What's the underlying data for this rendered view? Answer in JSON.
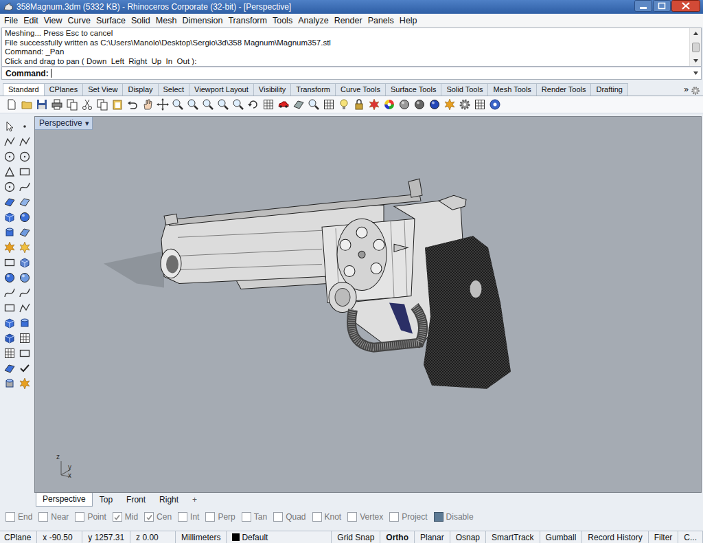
{
  "window": {
    "title": "358Magnum.3dm (5332 KB) - Rhinoceros Corporate (32-bit) - [Perspective]"
  },
  "menu": [
    "File",
    "Edit",
    "View",
    "Curve",
    "Surface",
    "Solid",
    "Mesh",
    "Dimension",
    "Transform",
    "Tools",
    "Analyze",
    "Render",
    "Panels",
    "Help"
  ],
  "command_history": [
    "Meshing... Press Esc to cancel",
    "File successfully written as C:\\Users\\Manolo\\Desktop\\Sergio\\3d\\358 Magnum\\Magnum357.stl",
    "Command: _Pan",
    "Click and drag to pan ( Down  Left  Right  Up  In  Out ):"
  ],
  "command_line": {
    "label": "Command:"
  },
  "toolbar_tabs": [
    {
      "label": "Standard",
      "selected": true
    },
    {
      "label": "CPlanes",
      "selected": false
    },
    {
      "label": "Set View",
      "selected": false
    },
    {
      "label": "Display",
      "selected": false
    },
    {
      "label": "Select",
      "selected": false
    },
    {
      "label": "Viewport Layout",
      "selected": false
    },
    {
      "label": "Visibility",
      "selected": false
    },
    {
      "label": "Transform",
      "selected": false
    },
    {
      "label": "Curve Tools",
      "selected": false
    },
    {
      "label": "Surface Tools",
      "selected": false
    },
    {
      "label": "Solid Tools",
      "selected": false
    },
    {
      "label": "Mesh Tools",
      "selected": false
    },
    {
      "label": "Render Tools",
      "selected": false
    },
    {
      "label": "Drafting",
      "selected": false
    }
  ],
  "toolbar_tabs_more": "»",
  "viewport": {
    "label": "Perspective",
    "menu_glyph": "▾",
    "axes": [
      "z",
      "y",
      "x"
    ]
  },
  "viewport_tabs": [
    {
      "label": "Perspective",
      "selected": true
    },
    {
      "label": "Top",
      "selected": false
    },
    {
      "label": "Front",
      "selected": false
    },
    {
      "label": "Right",
      "selected": false
    }
  ],
  "viewport_tab_add": "+",
  "osnaps": [
    {
      "label": "End",
      "checked": false,
      "kind": "check"
    },
    {
      "label": "Near",
      "checked": false,
      "kind": "check"
    },
    {
      "label": "Point",
      "checked": false,
      "kind": "check"
    },
    {
      "label": "Mid",
      "checked": true,
      "kind": "check"
    },
    {
      "label": "Cen",
      "checked": true,
      "kind": "check"
    },
    {
      "label": "Int",
      "checked": false,
      "kind": "check"
    },
    {
      "label": "Perp",
      "checked": false,
      "kind": "check"
    },
    {
      "label": "Tan",
      "checked": false,
      "kind": "check"
    },
    {
      "label": "Quad",
      "checked": false,
      "kind": "check"
    },
    {
      "label": "Knot",
      "checked": false,
      "kind": "check"
    },
    {
      "label": "Vertex",
      "checked": false,
      "kind": "check"
    },
    {
      "label": "Project",
      "checked": false,
      "kind": "check"
    },
    {
      "label": "Disable",
      "checked": false,
      "kind": "toggle"
    }
  ],
  "status_bar": {
    "cplane": "CPlane",
    "coords": [
      "x -90.50",
      "y 1257.31",
      "z 0.00"
    ],
    "units": "Millimeters",
    "layer": {
      "name": "Default",
      "color": "#000000"
    },
    "toggles": [
      {
        "label": "Grid Snap",
        "on": false
      },
      {
        "label": "Ortho",
        "on": true
      },
      {
        "label": "Planar",
        "on": false
      },
      {
        "label": "Osnap",
        "on": false
      },
      {
        "label": "SmartTrack",
        "on": false
      },
      {
        "label": "Gumball",
        "on": false
      },
      {
        "label": "Record History",
        "on": false
      },
      {
        "label": "Filter",
        "on": false
      },
      {
        "label": "C...",
        "on": false
      }
    ]
  }
}
